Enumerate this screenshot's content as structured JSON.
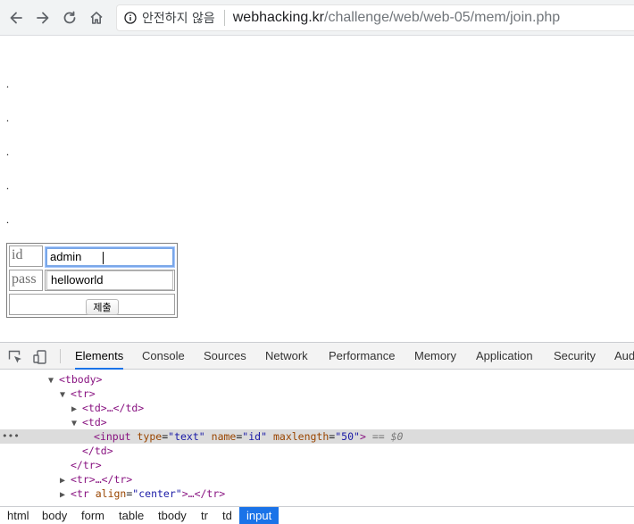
{
  "browser": {
    "security_label": "안전하지 않음",
    "url_host": "webhacking.kr",
    "url_path": "/challenge/web/web-05/mem/join.php"
  },
  "page": {
    "dots": [
      ".",
      ".",
      ".",
      ".",
      "."
    ],
    "form": {
      "id_label": "id",
      "id_value": "admin",
      "pass_label": "pass",
      "pass_value": "helloworld",
      "submit_label": "제출"
    }
  },
  "devtools": {
    "tabs": [
      "Elements",
      "Console",
      "Sources",
      "Network",
      "Performance",
      "Memory",
      "Application",
      "Security",
      "Aud"
    ],
    "active_tab": "Elements",
    "dom": {
      "tbody_open": "<tbody>",
      "tr_open": "<tr>",
      "td_collapsed": "<td>…</td>",
      "td_open": "<td>",
      "input_tag": "input",
      "input_type_name": "type",
      "input_type_value": "text",
      "input_name_name": "name",
      "input_name_value": "id",
      "input_maxlength_name": "maxlength",
      "input_maxlength_value": "50",
      "selected_marker": "== $0",
      "td_close": "</td>",
      "tr_close": "</tr>",
      "tr_collapsed": "<tr>…</tr>",
      "tr_align_tag": "tr",
      "tr_align_attr": "align",
      "tr_align_value": "center"
    },
    "breadcrumbs": [
      "html",
      "body",
      "form",
      "table",
      "tbody",
      "tr",
      "td",
      "input"
    ],
    "active_breadcrumb": "input"
  }
}
